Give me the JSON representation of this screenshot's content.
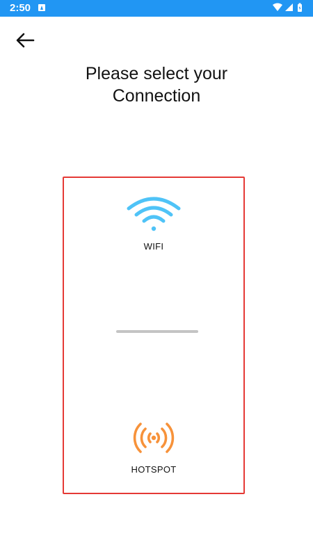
{
  "status_bar": {
    "time": "2:50",
    "background": "#2196f3",
    "icons": [
      "a-notification-icon",
      "wifi-signal-icon",
      "cell-signal-icon",
      "battery-icon"
    ]
  },
  "header": {
    "back_icon": "arrow-left-icon",
    "title_line1": "Please select your",
    "title_line2": "Connection"
  },
  "options": {
    "wifi": {
      "label": "WIFI",
      "icon": "wifi-icon",
      "color": "#4fc3f7"
    },
    "hotspot": {
      "label": "HOTSPOT",
      "icon": "hotspot-icon",
      "color": "#f7923a"
    }
  },
  "card": {
    "border_color": "#e53935"
  }
}
